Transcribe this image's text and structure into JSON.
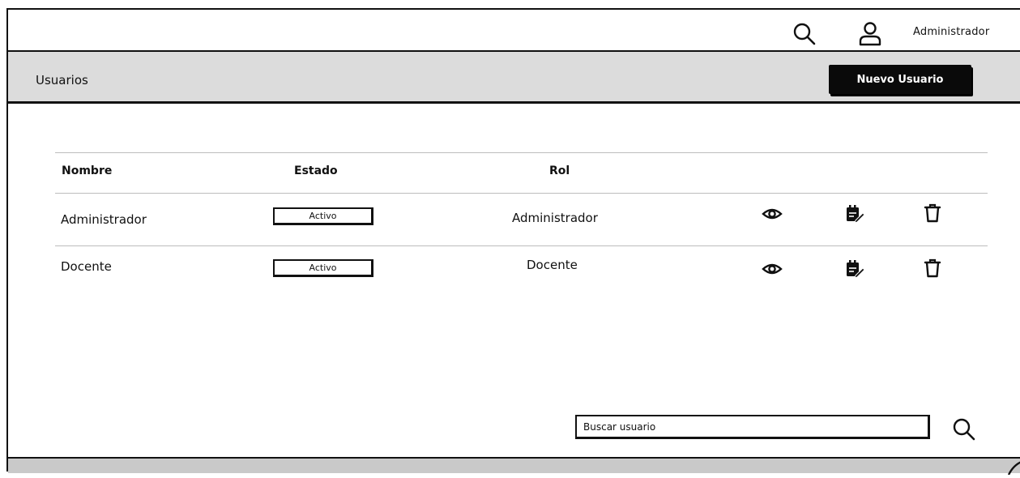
{
  "topbar": {
    "search_icon": "search-icon",
    "user_icon": "user-icon",
    "user_name": "Administrador"
  },
  "header": {
    "title": "Usuarios",
    "new_user_button": "Nuevo Usuario"
  },
  "table": {
    "columns": [
      "Nombre",
      "Estado",
      "Rol"
    ],
    "rows": [
      {
        "name": "Administrador",
        "status": "Activo",
        "role": "Administrador"
      },
      {
        "name": "Docente",
        "status": "Activo",
        "role": "Docente"
      }
    ],
    "row_actions": [
      "view-icon",
      "edit-icon",
      "delete-icon"
    ]
  },
  "search": {
    "placeholder": "Buscar usuario"
  },
  "colors": {
    "header_bg": "#dcdcdc",
    "button_bg": "#0a0a0a",
    "footer_bg": "#c9c9c9"
  }
}
